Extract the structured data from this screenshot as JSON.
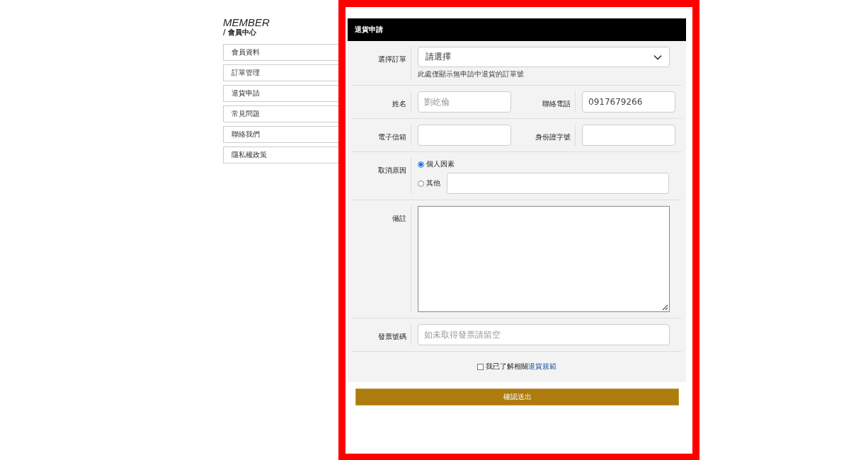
{
  "sidebar": {
    "title": "MEMBER",
    "subtitle": "/ 會員中心",
    "items": [
      {
        "label": "會員資料"
      },
      {
        "label": "訂單管理"
      },
      {
        "label": "退貨申請"
      },
      {
        "label": "常見問題"
      },
      {
        "label": "聯絡我們"
      },
      {
        "label": "隱私權政策"
      }
    ]
  },
  "form": {
    "highlighted": true,
    "title": "退貨申請",
    "rows": [
      {
        "kind": "select",
        "label": "選擇訂單",
        "value": "請選擇",
        "note": "此處僅顯示無申請中退貨的訂單號"
      },
      {
        "kind": "pair",
        "fields": [
          {
            "label": "姓名",
            "placeholder": "劉屹倫"
          },
          {
            "label": "聯絡電話",
            "value": "0917679266"
          }
        ]
      },
      {
        "kind": "pair",
        "fields": [
          {
            "label": "電子信箱"
          },
          {
            "label": "身份證字號"
          }
        ]
      },
      {
        "kind": "radios",
        "label": "取消原因",
        "options": [
          {
            "kind": "plain",
            "label": "個人因素",
            "selected": true
          },
          {
            "kind": "input",
            "label": "其他",
            "selected": false
          }
        ]
      },
      {
        "kind": "textarea",
        "label": "備註"
      },
      {
        "kind": "text",
        "label": "發票號碼",
        "placeholder": "如未取得發票請留空"
      }
    ],
    "agreement": {
      "text": "我已了解相關",
      "link": "退貨規範",
      "checked": false
    },
    "submit": "確認送出"
  }
}
